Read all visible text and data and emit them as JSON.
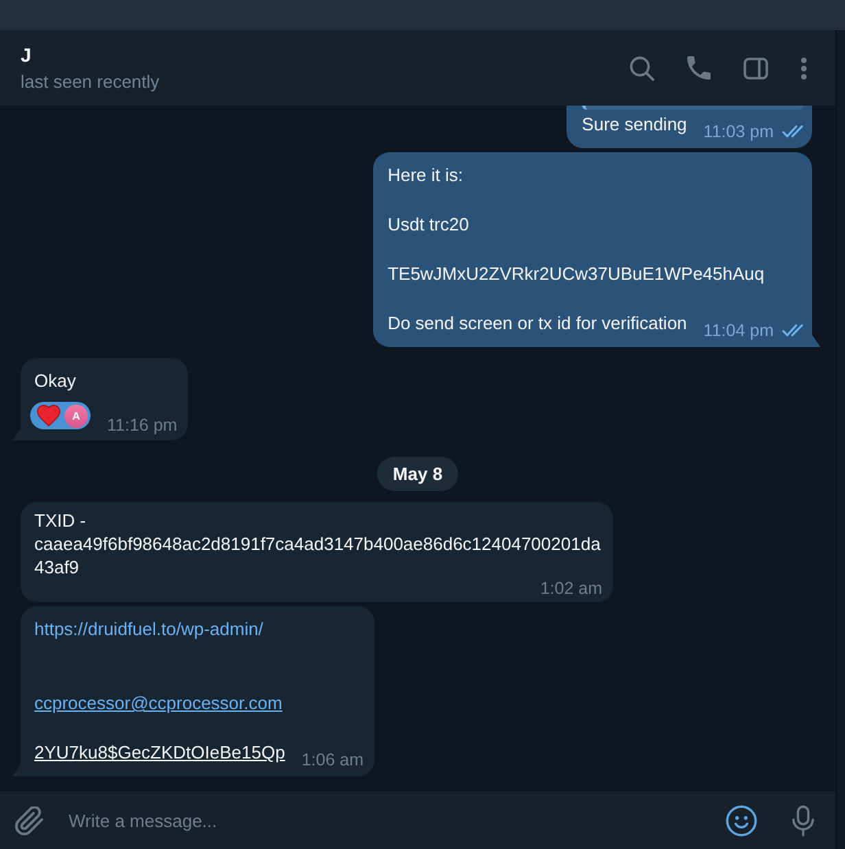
{
  "header": {
    "title": "J",
    "status": "last seen recently"
  },
  "messages": [
    {
      "kind": "message",
      "outgoing": true,
      "reply": true,
      "lines": [
        {
          "kind": "plain",
          "text": "Sure sending"
        }
      ],
      "time": "11:03 pm",
      "read": true
    },
    {
      "kind": "message",
      "outgoing": true,
      "reply": false,
      "lines": [
        {
          "kind": "plain",
          "text": "Here it is:"
        },
        {
          "kind": "blank"
        },
        {
          "kind": "plain",
          "text": "Usdt trc20"
        },
        {
          "kind": "blank"
        },
        {
          "kind": "plain",
          "text": "TE5wJMxU2ZVRkr2UCw37UBuE1WPe45hAuq"
        },
        {
          "kind": "blank"
        },
        {
          "kind": "plain",
          "text": "Do send screen or tx id for verification"
        }
      ],
      "time": "11:04 pm",
      "read": true
    },
    {
      "kind": "message",
      "outgoing": false,
      "reply": false,
      "lines": [
        {
          "kind": "plain",
          "text": "Okay"
        }
      ],
      "reactions": [
        {
          "reactor": "A"
        }
      ],
      "time": "11:16 pm"
    },
    {
      "kind": "date",
      "text": "May 8"
    },
    {
      "kind": "message",
      "outgoing": false,
      "reply": false,
      "lines": [
        {
          "kind": "plain",
          "text": "TXID - caaea49f6bf98648ac2d8191f7ca4ad3147b400ae86d6c12404700201da43af9"
        }
      ],
      "time": "1:02 am"
    },
    {
      "kind": "message",
      "outgoing": false,
      "reply": false,
      "lines": [
        {
          "kind": "url",
          "text": "https://druidfuel.to/wp-admin/"
        },
        {
          "kind": "blank"
        },
        {
          "kind": "blank"
        },
        {
          "kind": "email",
          "text": "ccprocessor@ccprocessor.com"
        },
        {
          "kind": "blank"
        },
        {
          "kind": "underlined",
          "text": "2YU7ku8$GecZKDtOIeBe15Qp"
        }
      ],
      "time": "1:06 am"
    }
  ],
  "composer": {
    "placeholder": "Write a message..."
  }
}
